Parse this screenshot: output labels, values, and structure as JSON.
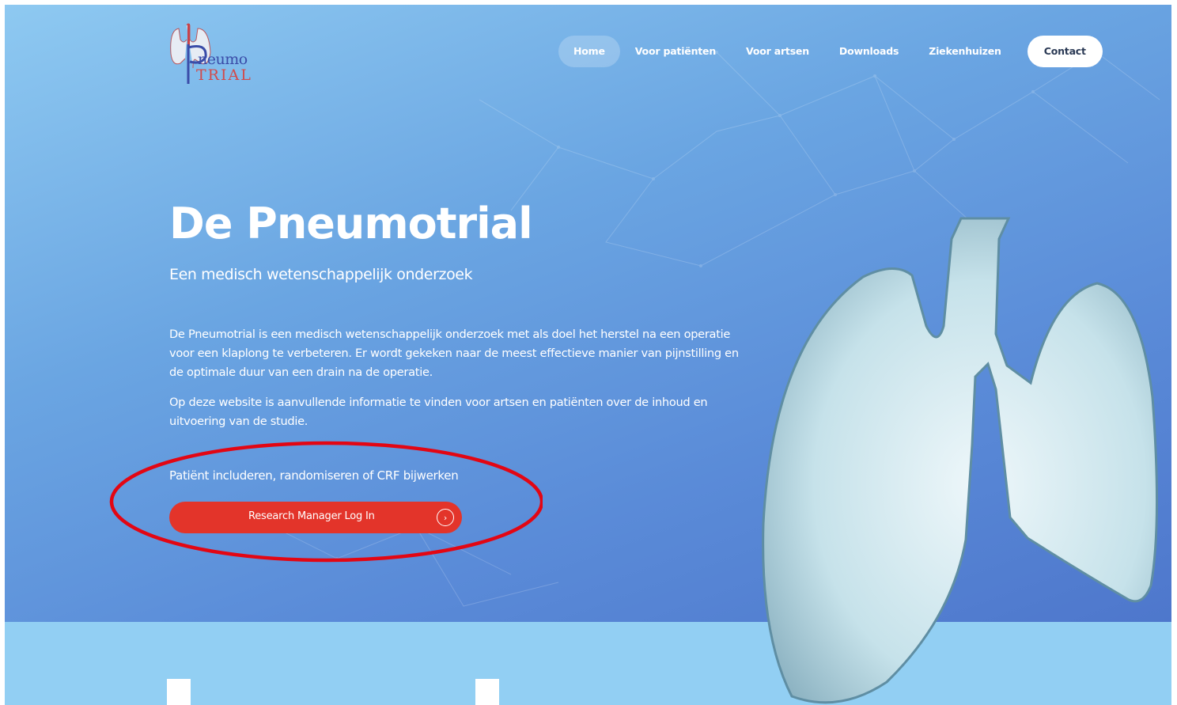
{
  "logo": {
    "line1": "neumo",
    "line2": "TRIAL"
  },
  "nav": {
    "items": [
      {
        "label": "Home"
      },
      {
        "label": "Voor patiënten"
      },
      {
        "label": "Voor artsen"
      },
      {
        "label": "Downloads"
      },
      {
        "label": "Ziekenhuizen"
      }
    ],
    "contact_label": "Contact",
    "active": "Home"
  },
  "hero": {
    "title": "De Pneumotrial",
    "subtitle": "Een medisch wetenschappelijk onderzoek",
    "paragraph1": "De Pneumotrial is een medisch wetenschappelijk onderzoek met als doel het herstel na een operatie voor een klaplong te verbeteren. Er wordt gekeken naar de meest effectieve manier van pijnstilling en de optimale duur van een drain na de operatie.",
    "paragraph2": "Op deze website is aanvullende informatie te vinden voor artsen en patiënten over de inhoud en uitvoering van de studie.",
    "cta_label": "Patiënt includeren, randomiseren of CRF bijwerken",
    "cta_button": "Research Manager Log In",
    "cta_icon": "chevron-right-circle-icon"
  },
  "colors": {
    "hero_top": "#8ec9f1",
    "hero_bottom": "#4e77cc",
    "cta": "#e3342a",
    "annotation": "#e30613",
    "band": "#92cff3"
  }
}
